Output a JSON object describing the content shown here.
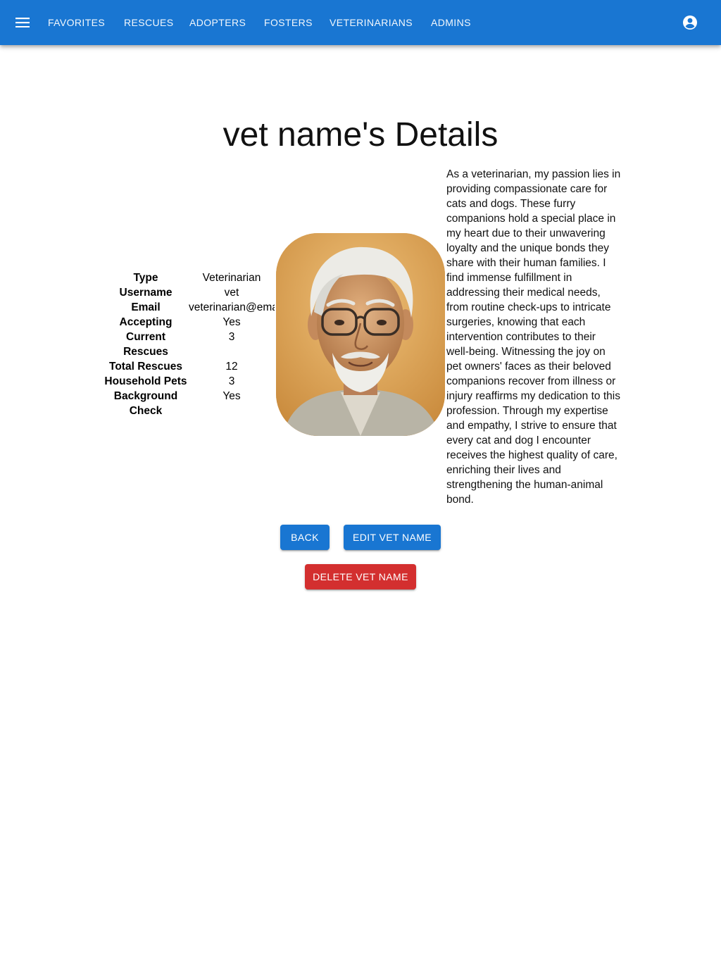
{
  "nav": {
    "menu_icon": "menu-icon",
    "items": [
      {
        "label": "FAVORITES"
      },
      {
        "label": "RESCUES"
      },
      {
        "label": "ADOPTERS"
      },
      {
        "label": "FOSTERS"
      },
      {
        "label": "VETERINARIANS"
      },
      {
        "label": "ADMINS"
      }
    ],
    "account_icon": "account-circle-icon"
  },
  "page": {
    "title": "vet name's Details"
  },
  "details": [
    {
      "label": "Type",
      "value": "Veterinarian"
    },
    {
      "label": "Username",
      "value": "vet"
    },
    {
      "label": "Email",
      "value": "veterinarian@email.com"
    },
    {
      "label": "Accepting",
      "value": "Yes"
    },
    {
      "label": "Current Rescues",
      "value": "3"
    },
    {
      "label": "Total Rescues",
      "value": "12"
    },
    {
      "label": "Household Pets",
      "value": "3"
    },
    {
      "label": "Background Check",
      "value": "Yes"
    }
  ],
  "bio": "As a veterinarian, my passion lies in providing compassionate care for cats and dogs. These furry companions hold a special place in my heart due to their unwavering loyalty and the unique bonds they share with their human families. I find immense fulfillment in addressing their medical needs, from routine check-ups to intricate surgeries, knowing that each intervention contributes to their well-being. Witnessing the joy on pet owners' faces as their beloved companions recover from illness or injury reaffirms my dedication to this profession. Through my expertise and empathy, I strive to ensure that every cat and dog I encounter receives the highest quality of care, enriching their lives and strengthening the human-animal bond.",
  "buttons": {
    "back": "BACK",
    "edit": "EDIT VET NAME",
    "delete": "DELETE VET NAME"
  },
  "colors": {
    "primary": "#1976d2",
    "danger": "#d32f2f"
  }
}
